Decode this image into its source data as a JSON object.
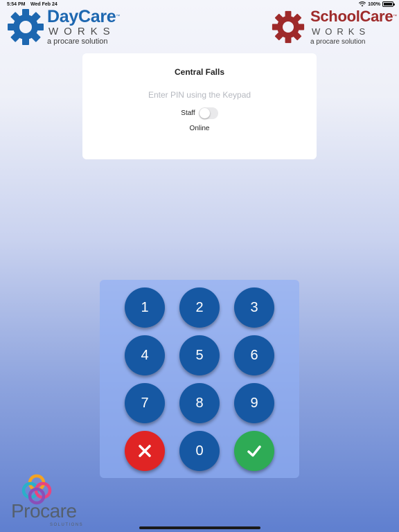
{
  "status_bar": {
    "time": "5:54 PM",
    "date": "Wed Feb 24",
    "battery": "100%"
  },
  "logos": {
    "daycare": {
      "name": "DayCare",
      "tm": "™",
      "sub": "WORKS",
      "tagline": "a procare solution"
    },
    "schoolcare": {
      "name": "SchoolCare",
      "tm": "™",
      "sub": "WORKS",
      "tagline": "a procare solution"
    },
    "procare": {
      "name": "Procare",
      "sub": "SOLUTIONS"
    }
  },
  "card": {
    "title": "Central Falls",
    "pin_prompt": "Enter PIN using the Keypad",
    "staff_label": "Staff",
    "staff_toggle_on": false,
    "status": "Online"
  },
  "keypad": {
    "keys": [
      "1",
      "2",
      "3",
      "4",
      "5",
      "6",
      "7",
      "8",
      "9",
      "0"
    ],
    "cancel_icon": "x-icon",
    "confirm_icon": "check-icon"
  },
  "colors": {
    "daycare_blue": "#1d67b0",
    "schoolcare_red": "#9e2a2a",
    "key_blue": "#1658a3",
    "cancel_red": "#e02424",
    "confirm_green": "#2eab55"
  }
}
